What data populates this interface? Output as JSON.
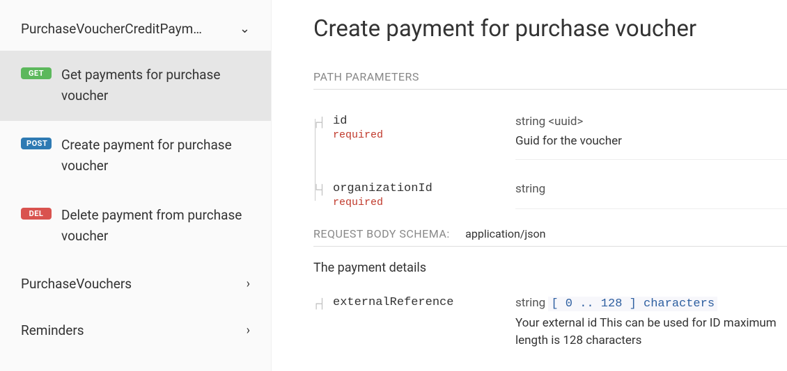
{
  "sidebar": {
    "group_title": "PurchaseVoucherCreditPaym…",
    "items": [
      {
        "method": "GET",
        "label": "Get payments for purchase voucher"
      },
      {
        "method": "POST",
        "label": "Create payment for purchase voucher"
      },
      {
        "method": "DEL",
        "label": "Delete payment from purchase voucher"
      }
    ],
    "simple": [
      {
        "label": "PurchaseVouchers"
      },
      {
        "label": "Reminders"
      }
    ]
  },
  "main": {
    "title": "Create payment for purchase voucher",
    "path_params_heading": "PATH PARAMETERS",
    "path_params": [
      {
        "name": "id",
        "required": "required",
        "type": "string <uuid>",
        "desc": "Guid for the voucher"
      },
      {
        "name": "organizationId",
        "required": "required",
        "type": "string",
        "desc": ""
      }
    ],
    "body_schema_heading": "REQUEST BODY SCHEMA:",
    "body_schema_type": "application/json",
    "body_desc": "The payment details",
    "body_params": [
      {
        "name": "externalReference",
        "type": "string",
        "constraint": "[ 0 .. 128 ] characters",
        "desc": "Your external id This can be used for ID maximum length is 128 characters"
      }
    ]
  }
}
